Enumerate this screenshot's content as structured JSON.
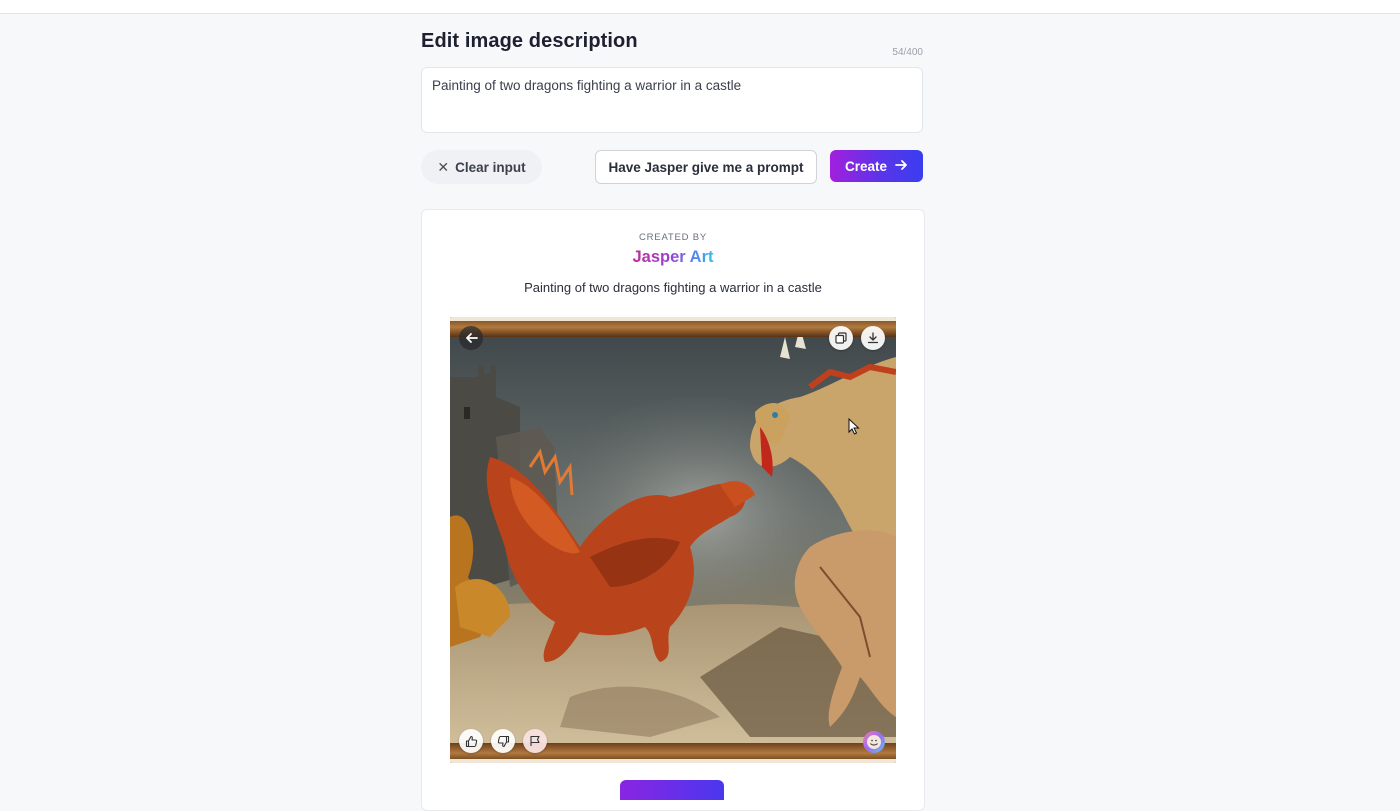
{
  "editor": {
    "title": "Edit image description",
    "char_count": "54/400",
    "description_value": "Painting of two dragons fighting a warrior in a castle"
  },
  "actions": {
    "clear_label": "Clear input",
    "prompt_label": "Have Jasper give me a prompt",
    "create_label": "Create"
  },
  "result": {
    "created_by": "CREATED BY",
    "brand": "Jasper Art",
    "caption": "Painting of two dragons fighting a warrior in a castle",
    "image_icons": [
      "arrow-left-icon",
      "copy-icon",
      "download-icon",
      "thumbs-up-icon",
      "thumbs-down-icon",
      "flag-icon",
      "avatar-icon"
    ]
  },
  "colors": {
    "create_gradient_start": "#a21fdd",
    "create_gradient_end": "#3a3df0",
    "background": "#f7f8fa"
  }
}
